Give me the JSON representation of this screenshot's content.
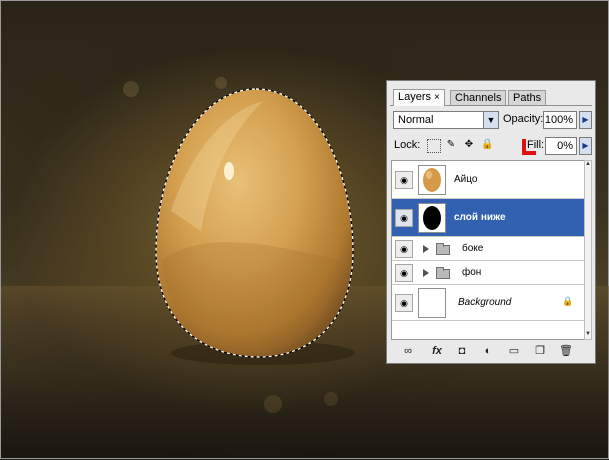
{
  "panel": {
    "tabs": [
      {
        "label": "Layers",
        "close": "×"
      },
      {
        "label": "Channels"
      },
      {
        "label": "Paths"
      }
    ],
    "blend_mode": "Normal",
    "opacity_label": "Opacity:",
    "opacity_value": "100%",
    "lock_label": "Lock:",
    "fill_label": "Fill:",
    "fill_value": "0%",
    "layers": [
      {
        "name": "Айцо",
        "visible": true
      },
      {
        "name": "слой ниже",
        "visible": true,
        "selected": true
      },
      {
        "name": "боке",
        "visible": true,
        "group": true
      },
      {
        "name": "фон",
        "visible": true,
        "group": true
      },
      {
        "name": "Background",
        "visible": true,
        "locked": true
      }
    ]
  },
  "colors": {
    "selection": "#3161b0",
    "accent_red": "#e01010",
    "egg_fill": "#c9954a"
  },
  "icons": {
    "eye": "eye-icon",
    "lock": "lock-icon",
    "link": "link-layers-icon",
    "fx": "fx-icon",
    "mask": "add-mask-icon",
    "adjust": "adjustment-layer-icon",
    "group": "new-group-icon",
    "new": "new-layer-icon",
    "trash": "trash-icon"
  }
}
